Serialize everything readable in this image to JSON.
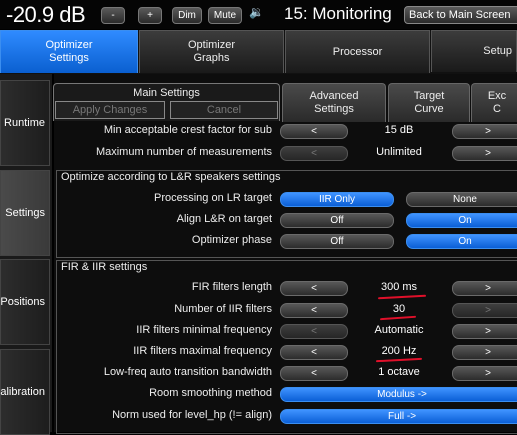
{
  "topbar": {
    "volume": "-20.9 dB",
    "minus": "-",
    "plus": "+",
    "dim": "Dim",
    "mute": "Mute",
    "speaker_icon": "🔉",
    "title": "15: Monitoring",
    "back": "Back to Main Screen"
  },
  "tabs": [
    {
      "label": "Optimizer\nSettings"
    },
    {
      "label": "Optimizer\nGraphs"
    },
    {
      "label": "Processor"
    },
    {
      "label": "Setup"
    }
  ],
  "sidebar": [
    {
      "label": "Runtime"
    },
    {
      "label": "Settings"
    },
    {
      "label": "Positions"
    },
    {
      "label": "Calibration"
    }
  ],
  "subtabs": {
    "main": "Main Settings",
    "apply": "Apply Changes",
    "cancel": "Cancel",
    "advanced": "Advanced\nSettings",
    "target": "Target\nCurve",
    "exc": "Exc\nC"
  },
  "rows_top": [
    {
      "label": "Min acceptable crest factor for sub",
      "left": "<",
      "value": "15 dB",
      "right": ">"
    },
    {
      "label": "Maximum number of measurements",
      "left": "<",
      "value": "Unlimited",
      "right": ">"
    }
  ],
  "lr_section": {
    "title": "Optimize according to L&R speakers settings",
    "rows": [
      {
        "label": "Processing on LR target",
        "opt1": "IIR Only",
        "opt2": "None"
      },
      {
        "label": "Align L&R on target",
        "opt1": "Off",
        "opt2": "On"
      },
      {
        "label": "Optimizer phase",
        "opt1": "Off",
        "opt2": "On"
      }
    ]
  },
  "fir_section": {
    "title": "FIR & IIR settings",
    "rows": [
      {
        "label": "FIR filters length",
        "left": "<",
        "value": "300 ms",
        "right": ">"
      },
      {
        "label": "Number of IIR filters",
        "left": "<",
        "value": "30",
        "right": ">"
      },
      {
        "label": "IIR filters minimal frequency",
        "left": "<",
        "value": "Automatic",
        "right": ">"
      },
      {
        "label": "IIR filters maximal frequency",
        "left": "<",
        "value": "200 Hz",
        "right": ">"
      },
      {
        "label": "Low-freq auto transition bandwidth",
        "left": "<",
        "value": "1 octave",
        "right": ">"
      }
    ],
    "wide_rows": [
      {
        "label": "Room smoothing method",
        "value": "Modulus ->"
      },
      {
        "label": "Norm used for level_hp (!= align)",
        "value": "Full ->"
      }
    ]
  },
  "colors": {
    "accent": "#1a73e8",
    "annotation": "#e0102a"
  }
}
